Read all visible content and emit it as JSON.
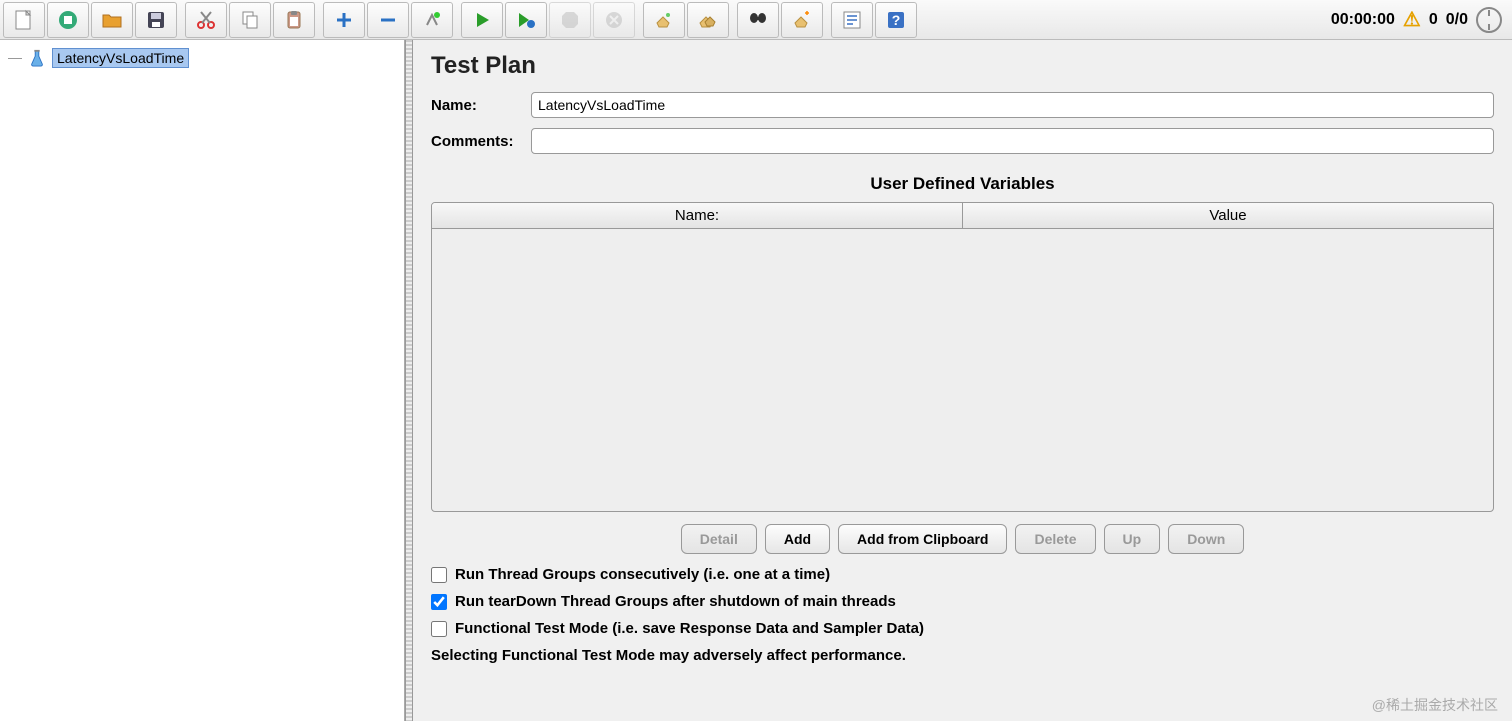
{
  "toolbar": {
    "icons": [
      "new",
      "templates",
      "open",
      "save",
      "cut",
      "copy",
      "paste",
      "expand",
      "collapse",
      "toggle",
      "start",
      "start-no-timers",
      "stop",
      "shutdown",
      "clear",
      "clear-all",
      "search",
      "reset-search",
      "function-helper",
      "help"
    ],
    "timer": "00:00:00",
    "warn_count": "0",
    "thread_status": "0/0"
  },
  "tree": {
    "root_label": "LatencyVsLoadTime"
  },
  "panel": {
    "title": "Test Plan",
    "name_label": "Name:",
    "name_value": "LatencyVsLoadTime",
    "comments_label": "Comments:",
    "comments_value": "",
    "vars_title": "User Defined Variables",
    "col_name": "Name:",
    "col_value": "Value",
    "buttons": {
      "detail": "Detail",
      "add": "Add",
      "add_clip": "Add from Clipboard",
      "delete": "Delete",
      "up": "Up",
      "down": "Down"
    },
    "cb_consecutive": "Run Thread Groups consecutively (i.e. one at a time)",
    "cb_teardown": "Run tearDown Thread Groups after shutdown of main threads",
    "cb_functional": "Functional Test Mode (i.e. save Response Data and Sampler Data)",
    "functional_note": "Selecting Functional Test Mode may adversely affect performance.",
    "cb_consecutive_checked": false,
    "cb_teardown_checked": true,
    "cb_functional_checked": false
  },
  "watermark": "@稀土掘金技术社区"
}
